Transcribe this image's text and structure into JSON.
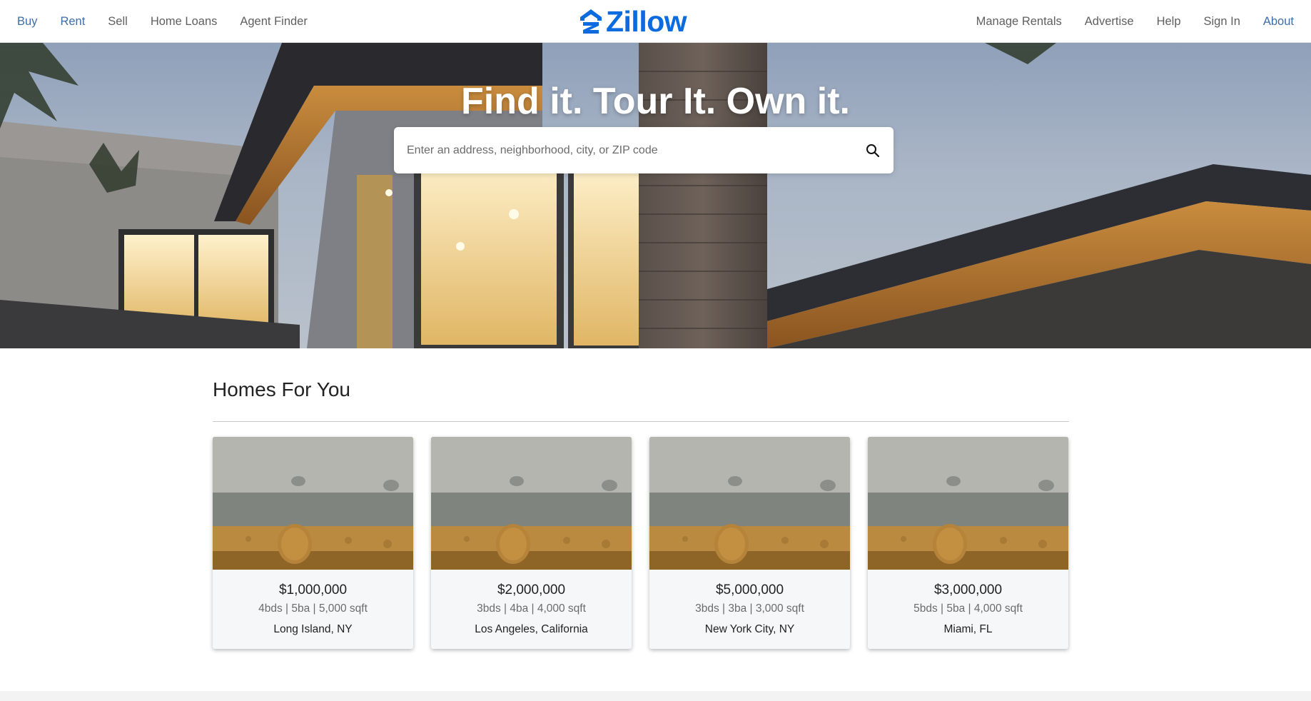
{
  "nav": {
    "left": [
      {
        "label": "Buy",
        "accent": true
      },
      {
        "label": "Rent",
        "accent": true
      },
      {
        "label": "Sell",
        "accent": false
      },
      {
        "label": "Home Loans",
        "accent": false
      },
      {
        "label": "Agent Finder",
        "accent": false
      }
    ],
    "right": [
      {
        "label": "Manage Rentals",
        "accent": false
      },
      {
        "label": "Advertise",
        "accent": false
      },
      {
        "label": "Help",
        "accent": false
      },
      {
        "label": "Sign In",
        "accent": false
      },
      {
        "label": "About",
        "accent": true
      }
    ],
    "logo_text": "Zillow",
    "logo_icon": "zillow-house-icon"
  },
  "hero": {
    "title": "Find it. Tour It. Own it.",
    "search": {
      "placeholder": "Enter an address, neighborhood, city, or ZIP code",
      "value": "",
      "icon": "search-icon"
    }
  },
  "homes": {
    "title": "Homes For You",
    "listings": [
      {
        "price": "$1,000,000",
        "specs": "4bds | 5ba | 5,000 sqft",
        "location": "Long Island, NY"
      },
      {
        "price": "$2,000,000",
        "specs": "3bds | 4ba | 4,000 sqft",
        "location": "Los Angeles, California"
      },
      {
        "price": "$5,000,000",
        "specs": "3bds | 3ba | 3,000 sqft",
        "location": "New York City, NY"
      },
      {
        "price": "$3,000,000",
        "specs": "5bds | 5ba | 4,000 sqft",
        "location": "Miami, FL"
      }
    ]
  },
  "colors": {
    "brand": "#0d6be0",
    "nav_accent": "#3d6ea8",
    "nav_text": "#5f5f5f"
  }
}
